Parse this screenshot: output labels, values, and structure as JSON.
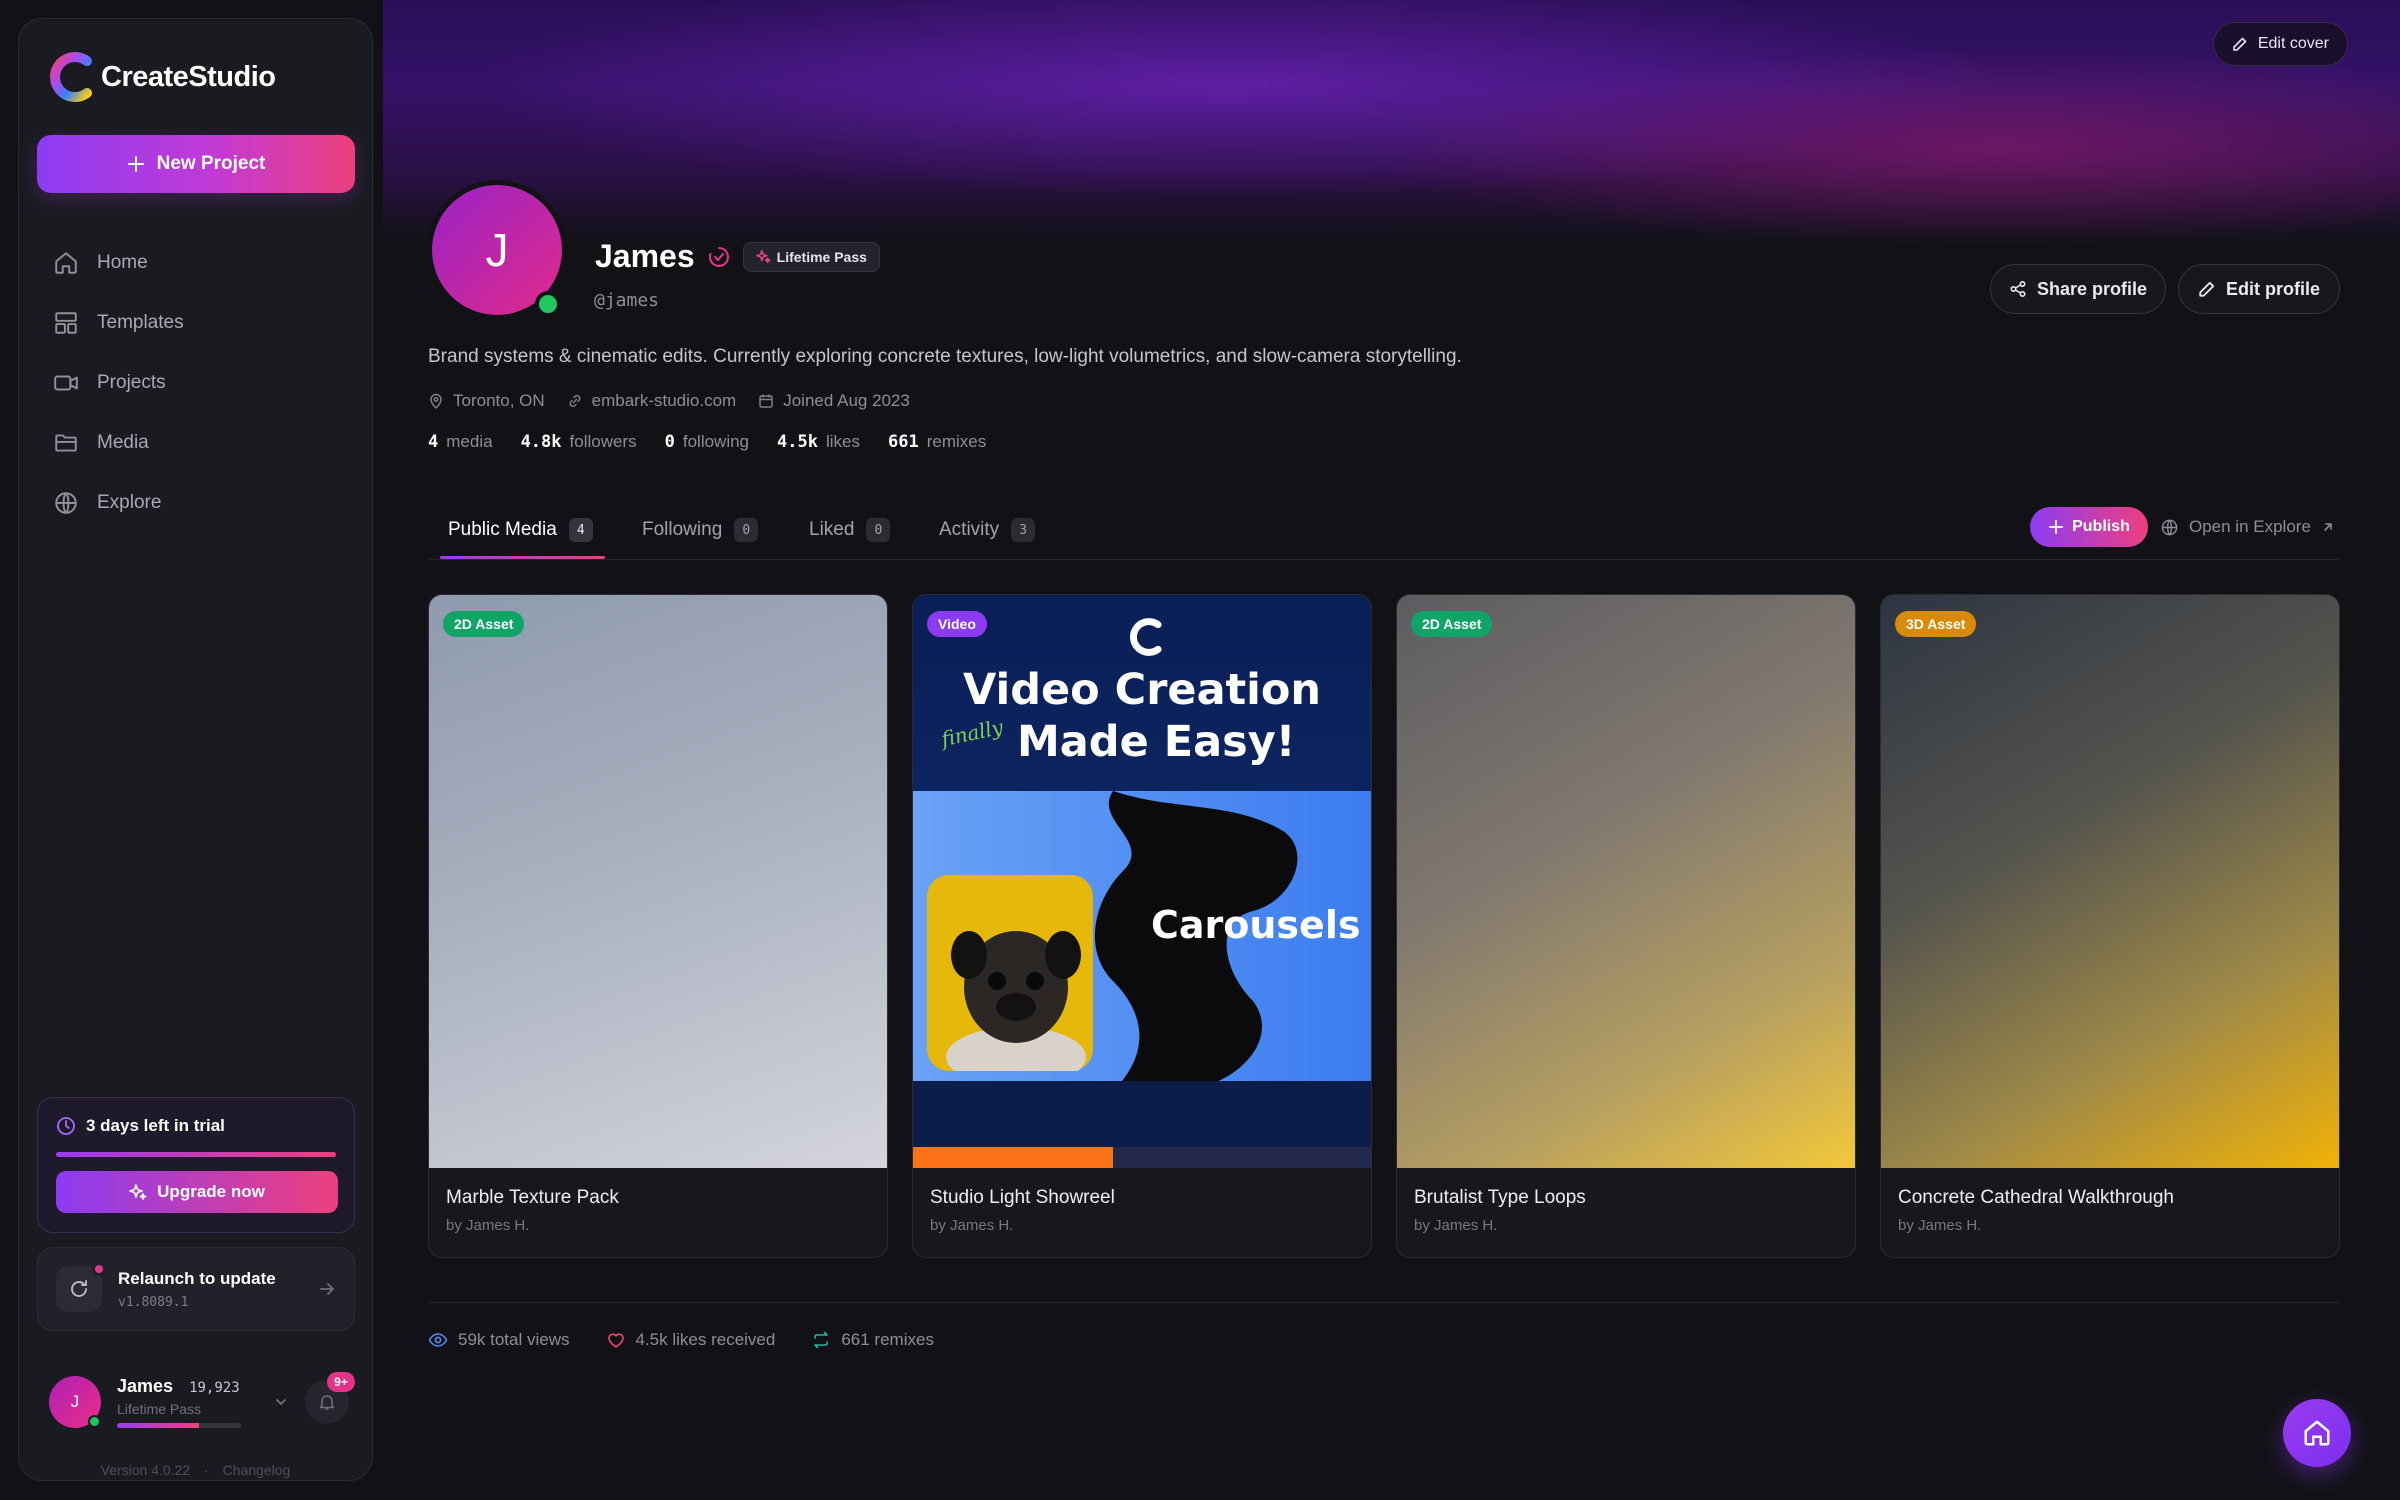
{
  "app": {
    "name": "CreateStudio"
  },
  "sidebar": {
    "new_project_label": "New Project",
    "nav": [
      {
        "label": "Home",
        "icon": "home-icon"
      },
      {
        "label": "Templates",
        "icon": "templates-icon"
      },
      {
        "label": "Projects",
        "icon": "video-icon"
      },
      {
        "label": "Media",
        "icon": "folder-icon"
      },
      {
        "label": "Explore",
        "icon": "globe-icon"
      }
    ],
    "trial": {
      "text": "3 days left in trial",
      "upgrade_label": "Upgrade now",
      "progress": 1.0
    },
    "relaunch": {
      "title": "Relaunch to update",
      "version": "v1.8089.1"
    },
    "user": {
      "initial": "J",
      "name": "James",
      "credits": "19,923",
      "plan": "Lifetime Pass",
      "level_progress": 0.66,
      "notifications": "9+"
    },
    "footer": {
      "version": "Version 4.0.22",
      "separator": "·",
      "changelog": "Changelog"
    }
  },
  "profile": {
    "edit_cover_label": "Edit cover",
    "initial": "J",
    "name": "James",
    "badge": "Lifetime Pass",
    "handle": "@james",
    "share_label": "Share profile",
    "edit_label": "Edit profile",
    "bio": "Brand systems & cinematic edits. Currently exploring concrete textures, low-light volumetrics, and slow-camera storytelling.",
    "location": "Toronto, ON",
    "website": "embark-studio.com",
    "joined": "Joined Aug 2023",
    "stats": [
      {
        "value": "4",
        "label": "media"
      },
      {
        "value": "4.8k",
        "label": "followers"
      },
      {
        "value": "0",
        "label": "following"
      },
      {
        "value": "4.5k",
        "label": "likes"
      },
      {
        "value": "661",
        "label": "remixes"
      }
    ]
  },
  "tabs": [
    {
      "label": "Public Media",
      "count": "4"
    },
    {
      "label": "Following",
      "count": "0"
    },
    {
      "label": "Liked",
      "count": "0"
    },
    {
      "label": "Activity",
      "count": "3"
    }
  ],
  "actions": {
    "publish_label": "Publish",
    "open_explore_label": "Open in Explore"
  },
  "media": [
    {
      "badge": "2D Asset",
      "badge_color": "#10a567",
      "title": "Marble Texture Pack",
      "author": "by James H."
    },
    {
      "badge": "Video",
      "badge_color": "#8b3cf2",
      "title": "Studio Light Showreel",
      "author": "by James H.",
      "thumb_heading_1": "Video Creation",
      "thumb_heading_2": "Made Easy!",
      "thumb_script": "finally",
      "thumb_word": "Carousels"
    },
    {
      "badge": "2D Asset",
      "badge_color": "#10a567",
      "title": "Brutalist Type Loops",
      "author": "by James H."
    },
    {
      "badge": "3D Asset",
      "badge_color": "#d98a0b",
      "title": "Concrete Cathedral Walkthrough",
      "author": "by James H."
    }
  ],
  "totals": {
    "views": "59k total views",
    "likes": "4.5k likes received",
    "remixes": "661 remixes"
  },
  "colors": {
    "accent_start": "#8b3cf2",
    "accent_end": "#ee3f7e",
    "online": "#22c55e"
  }
}
